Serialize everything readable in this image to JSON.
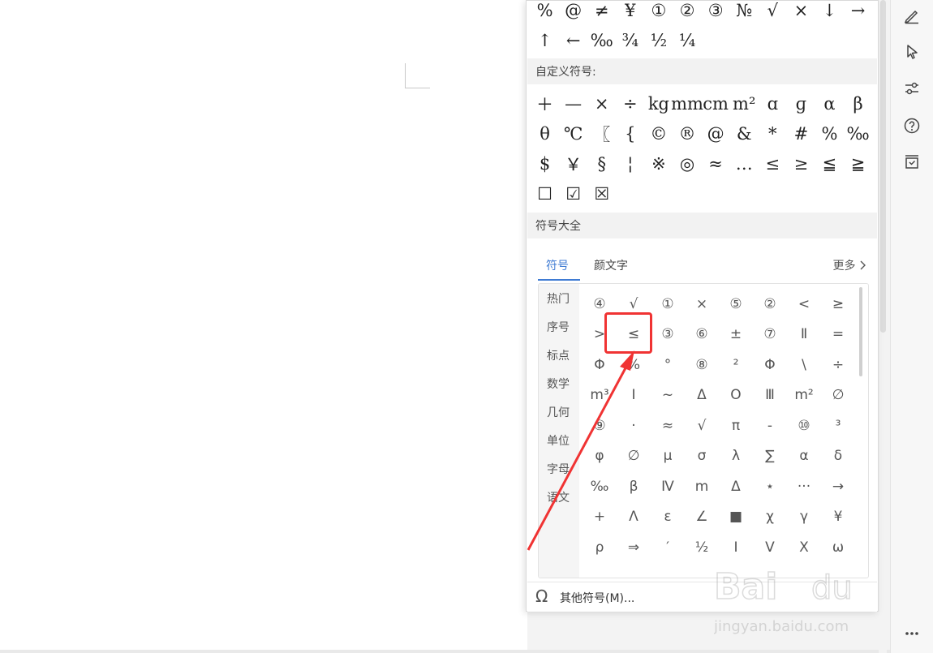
{
  "recent_symbols": [
    "%",
    "@",
    "≠",
    "¥",
    "①",
    "②",
    "③",
    "№",
    "√",
    "×",
    "↓",
    "→",
    "↑",
    "←",
    "‰",
    "¾",
    "½",
    "¼"
  ],
  "custom_section_title": "自定义符号:",
  "custom_symbols": [
    "＋",
    "—",
    "×",
    "÷",
    "kg",
    "mm",
    "cm",
    "m²",
    "ɑ",
    "ɡ",
    "α",
    "β",
    "θ",
    "℃",
    "〖",
    "{",
    "©",
    "®",
    "@",
    "&",
    "*",
    "#",
    "%",
    "‰",
    "$",
    "￥",
    "§",
    "¦",
    "※",
    "◎",
    "≈",
    "…",
    "≤",
    "≥",
    "≦",
    "≧",
    "☐",
    "☑",
    "☒"
  ],
  "all_symbols_title": "符号大全",
  "tabs": [
    {
      "label": "符号",
      "active": true
    },
    {
      "label": "颜文字",
      "active": false
    }
  ],
  "more_label": "更多",
  "categories": [
    "热门",
    "序号",
    "标点",
    "数学",
    "几何",
    "单位",
    "字母",
    "语文"
  ],
  "symbol_grid": [
    "④",
    "√",
    "①",
    "×",
    "⑤",
    "②",
    "<",
    "≥",
    ">",
    "≤",
    "③",
    "⑥",
    "±",
    "⑦",
    "Ⅱ",
    "=",
    "Φ",
    "%",
    "°",
    "⑧",
    "²",
    "Φ",
    "\\",
    "÷",
    "m³",
    "Ⅰ",
    "~",
    "Δ",
    "O",
    "Ⅲ",
    "m²",
    "∅",
    "⑨",
    "·",
    "≈",
    "√",
    "π",
    "-",
    "⑩",
    "³",
    "φ",
    "∅",
    "μ",
    "σ",
    "λ",
    "∑",
    "α",
    "δ",
    "‰",
    "β",
    "Ⅳ",
    "m",
    "Δ",
    "⋆",
    "···",
    "→",
    "+",
    "Λ",
    "ε",
    "∠",
    "■",
    "χ",
    "γ",
    "¥",
    "ρ",
    "⇒",
    "′",
    "½",
    "Ⅰ",
    "V",
    "X",
    "ω"
  ],
  "footer_label": "其他符号(M)...",
  "colors": {
    "accent": "#3f7bd3",
    "annotation": "#f03333"
  }
}
